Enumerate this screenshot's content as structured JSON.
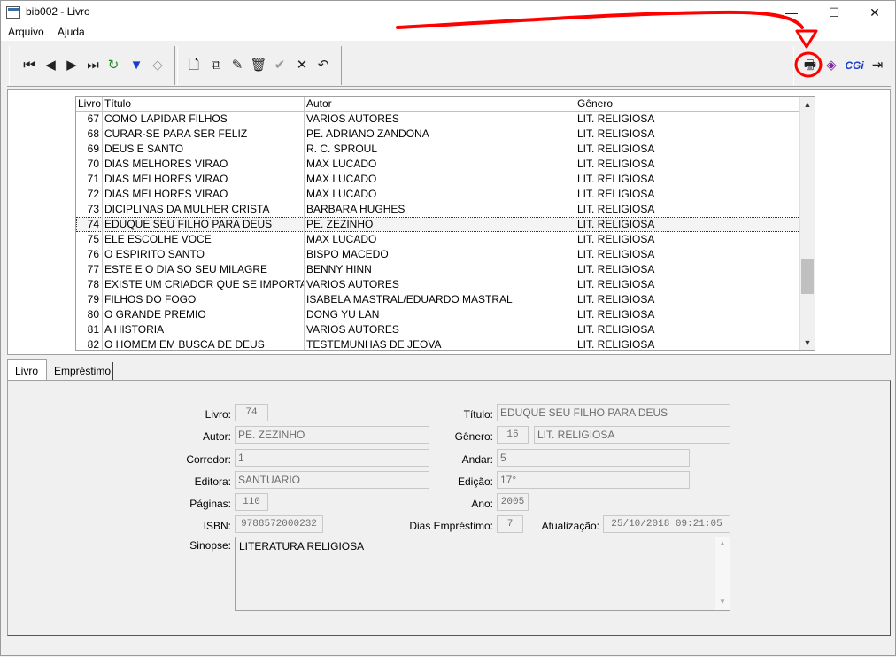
{
  "window": {
    "title": "bib002 - Livro",
    "minimize": "—",
    "maximize": "☐",
    "close": "✕"
  },
  "menu": [
    "Arquivo",
    "Ajuda"
  ],
  "toolbar": {
    "nav": [
      {
        "icon": "first-record-icon",
        "glyph": "⏮"
      },
      {
        "icon": "prior-record-icon",
        "glyph": "◀"
      },
      {
        "icon": "next-record-icon",
        "glyph": "▶"
      },
      {
        "icon": "last-record-icon",
        "glyph": "⏭"
      },
      {
        "icon": "refresh-icon",
        "glyph": "↻"
      },
      {
        "icon": "filter-icon",
        "glyph": "▼"
      },
      {
        "icon": "eraser-icon",
        "glyph": "◇"
      }
    ],
    "edit": [
      {
        "icon": "new-record-icon",
        "glyph": "🗋"
      },
      {
        "icon": "copy-record-icon",
        "glyph": "⧉"
      },
      {
        "icon": "edit-record-icon",
        "glyph": "✎"
      },
      {
        "icon": "delete-record-icon",
        "glyph": "🗑"
      },
      {
        "icon": "post-record-icon",
        "glyph": "✔"
      },
      {
        "icon": "cancel-record-icon",
        "glyph": "✕"
      },
      {
        "icon": "undo-icon",
        "glyph": "↶"
      }
    ],
    "right": [
      {
        "icon": "print-icon",
        "glyph": "🖶"
      },
      {
        "icon": "book-icon",
        "glyph": "◈"
      },
      {
        "icon": "cgi-icon",
        "glyph": "CGi"
      },
      {
        "icon": "exit-icon",
        "glyph": "⇥"
      }
    ],
    "accent": "#1a3ccc",
    "annotation_color": "#ff0000"
  },
  "grid": {
    "columns": [
      "Livro",
      "Título",
      "Autor",
      "Gênero"
    ],
    "selected_index": 7,
    "rows": [
      [
        "67",
        "COMO LAPIDAR FILHOS",
        "VARIOS AUTORES",
        "LIT. RELIGIOSA"
      ],
      [
        "68",
        "CURAR-SE PARA SER FELIZ",
        "PE. ADRIANO ZANDONA",
        "LIT. RELIGIOSA"
      ],
      [
        "69",
        "DEUS E SANTO",
        "R. C. SPROUL",
        "LIT. RELIGIOSA"
      ],
      [
        "70",
        "DIAS MELHORES VIRAO",
        "MAX LUCADO",
        "LIT. RELIGIOSA"
      ],
      [
        "71",
        "DIAS MELHORES VIRAO",
        "MAX LUCADO",
        "LIT. RELIGIOSA"
      ],
      [
        "72",
        "DIAS MELHORES VIRAO",
        "MAX LUCADO",
        "LIT. RELIGIOSA"
      ],
      [
        "73",
        "DICIPLINAS DA MULHER CRISTA",
        "BARBARA HUGHES",
        "LIT. RELIGIOSA"
      ],
      [
        "74",
        "EDUQUE SEU FILHO PARA DEUS",
        "PE. ZEZINHO",
        "LIT. RELIGIOSA"
      ],
      [
        "75",
        "ELE ESCOLHE VOCE",
        "MAX LUCADO",
        "LIT. RELIGIOSA"
      ],
      [
        "76",
        "O ESPIRITO SANTO",
        "BISPO MACEDO",
        "LIT. RELIGIOSA"
      ],
      [
        "77",
        "ESTE E O DIA SO SEU MILAGRE",
        "BENNY HINN",
        "LIT. RELIGIOSA"
      ],
      [
        "78",
        "EXISTE UM CRIADOR QUE SE IMPORTA CO",
        "VARIOS AUTORES",
        "LIT. RELIGIOSA"
      ],
      [
        "79",
        "FILHOS DO FOGO",
        "ISABELA MASTRAL/EDUARDO MASTRAL",
        "LIT. RELIGIOSA"
      ],
      [
        "80",
        "O GRANDE PREMIO",
        "DONG YU LAN",
        "LIT. RELIGIOSA"
      ],
      [
        "81",
        "A HISTORIA",
        "VARIOS AUTORES",
        "LIT. RELIGIOSA"
      ],
      [
        "82",
        "O HOMEM EM BUSCA DE DEUS",
        "TESTEMUNHAS DE JEOVA",
        "LIT. RELIGIOSA"
      ]
    ]
  },
  "tabs": [
    "Livro",
    "Empréstimo"
  ],
  "form": {
    "livro_label": "Livro:",
    "livro": "74",
    "titulo_label": "Título:",
    "titulo": "EDUQUE SEU FILHO PARA DEUS",
    "autor_label": "Autor:",
    "autor": "PE. ZEZINHO",
    "genero_label": "Gênero:",
    "genero_cod": "16",
    "genero": "LIT. RELIGIOSA",
    "corredor_label": "Corredor:",
    "corredor": "1",
    "andar_label": "Andar:",
    "andar": "5",
    "editora_label": "Editora:",
    "editora": "SANTUARIO",
    "edicao_label": "Edição:",
    "edicao": "17°",
    "paginas_label": "Páginas:",
    "paginas": "110",
    "ano_label": "Ano:",
    "ano": "2005",
    "isbn_label": "ISBN:",
    "isbn": "9788572000232",
    "dias_label": "Dias Empréstimo:",
    "dias": "7",
    "atualizacao_label": "Atualização:",
    "atualizacao": "25/10/2018 09:21:05",
    "sinopse_label": "Sinopse:",
    "sinopse": "LITERATURA RELIGIOSA"
  }
}
